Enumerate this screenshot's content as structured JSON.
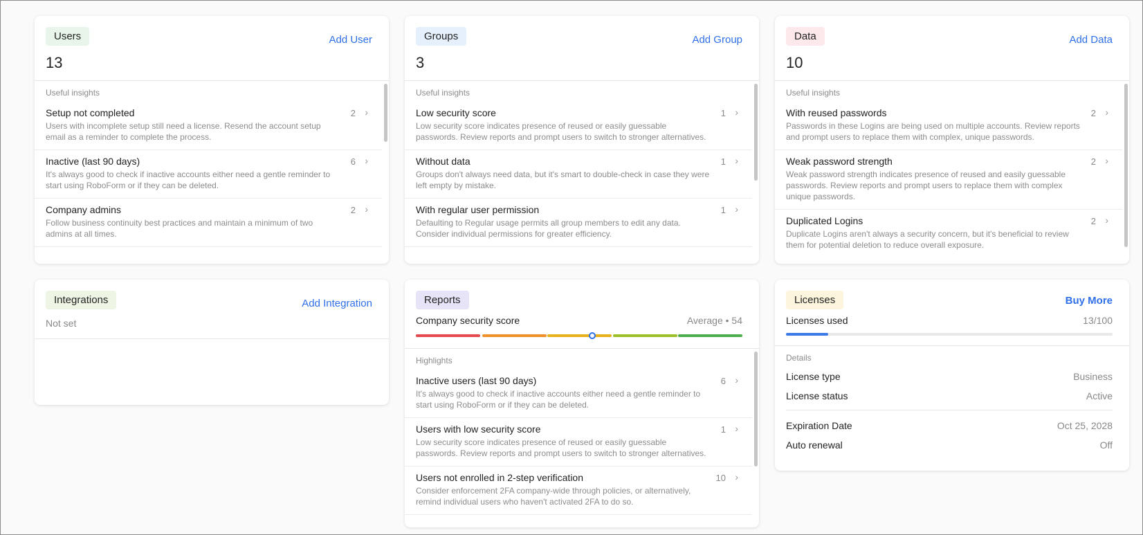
{
  "users": {
    "tag": "Users",
    "add": "Add User",
    "count": "13",
    "section": "Useful insights",
    "items": [
      {
        "title": "Setup not completed",
        "desc": "Users with incomplete setup still need a license. Resend the account setup email as a reminder to complete the process.",
        "count": "2"
      },
      {
        "title": "Inactive (last 90 days)",
        "desc": "It's always good to check if inactive accounts either need a gentle reminder to start using RoboForm or if they can be deleted.",
        "count": "6"
      },
      {
        "title": "Company admins",
        "desc": "Follow business continuity best practices and maintain a minimum of two admins at all times.",
        "count": "2"
      }
    ]
  },
  "groups": {
    "tag": "Groups",
    "add": "Add Group",
    "count": "3",
    "section": "Useful insights",
    "items": [
      {
        "title": "Low security score",
        "desc": "Low security score indicates presence of reused or easily guessable passwords. Review reports and prompt users to switch to stronger alternatives.",
        "count": "1"
      },
      {
        "title": "Without data",
        "desc": "Groups don't always need data, but it's smart to double-check in case they were left empty by mistake.",
        "count": "1"
      },
      {
        "title": "With regular user permission",
        "desc": "Defaulting to Regular usage permits all group members to edit any data. Consider individual permissions for greater efficiency.",
        "count": "1"
      }
    ]
  },
  "data": {
    "tag": "Data",
    "add": "Add Data",
    "count": "10",
    "section": "Useful insights",
    "items": [
      {
        "title": "With reused passwords",
        "desc": "Passwords in these Logins are being used on multiple accounts. Review reports and prompt users to replace them with complex, unique passwords.",
        "count": "2"
      },
      {
        "title": "Weak password strength",
        "desc": "Weak password strength indicates presence of reused and easily guessable passwords. Review reports and prompt users to replace them with complex unique passwords.",
        "count": "2"
      },
      {
        "title": "Duplicated Logins",
        "desc": "Duplicate Logins aren't always a security concern, but it's beneficial to review them for potential deletion to reduce overall exposure.",
        "count": "2"
      }
    ]
  },
  "integrations": {
    "tag": "Integrations",
    "add": "Add Integration",
    "status": "Not set"
  },
  "reports": {
    "tag": "Reports",
    "score_label": "Company security score",
    "score_value": "Average • 54",
    "score_fraction": 0.54,
    "section": "Highlights",
    "items": [
      {
        "title": "Inactive users (last 90 days)",
        "desc": "It's always good to check if inactive accounts either need a gentle reminder to start using RoboForm or if they can be deleted.",
        "count": "6"
      },
      {
        "title": "Users with low security score",
        "desc": "Low security score indicates presence of reused or easily guessable passwords. Review reports and prompt users to switch to stronger alternatives.",
        "count": "1"
      },
      {
        "title": "Users not enrolled in 2-step verification",
        "desc": "Consider enforcement 2FA company-wide through policies, or alternatively, remind individual users who haven't activated 2FA to do so.",
        "count": "10"
      }
    ],
    "score_colors": [
      "#e5484d",
      "#f0902a",
      "#e8b21c",
      "#9cbf2a",
      "#4cae4c"
    ]
  },
  "licenses": {
    "tag": "Licenses",
    "buy": "Buy More",
    "used_label": "Licenses used",
    "used_value": "13/100",
    "used_fraction": 0.13,
    "section": "Details",
    "type_label": "License type",
    "type_value": "Business",
    "status_label": "License status",
    "status_value": "Active",
    "exp_label": "Expiration Date",
    "exp_value": "Oct 25, 2028",
    "renew_label": "Auto renewal",
    "renew_value": "Off"
  },
  "colors": {
    "users_tag": "#e9f5ea",
    "groups_tag": "#e5f0fc",
    "data_tag": "#fde9ec",
    "integrations_tag": "#eff5e4",
    "reports_tag": "#e8e4f8",
    "licenses_tag": "#fdf5dd",
    "link": "#2f6fe8"
  }
}
